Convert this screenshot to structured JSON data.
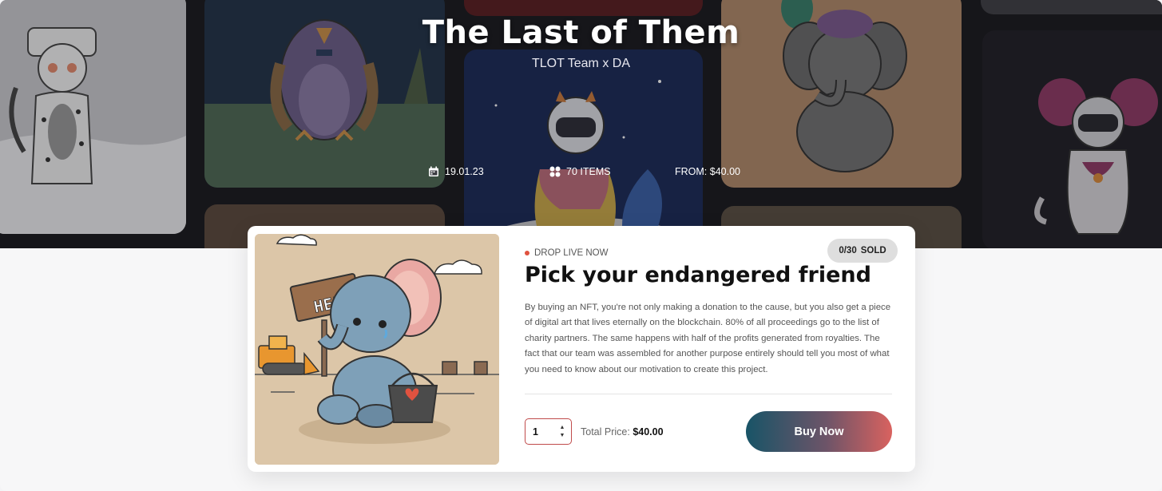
{
  "hero": {
    "title": "The Last of Them",
    "subtitle": "TLOT Team x DA",
    "meta": {
      "date": "19.01.23",
      "items": "70 ITEMS",
      "price_from": "FROM: $40.00"
    }
  },
  "drop": {
    "status": "DROP LIVE NOW",
    "sold_count": "0/30",
    "sold_label": "SOLD",
    "title": "Pick your endangered friend",
    "description": "By buying an NFT, you're not only making a donation to the cause, but you also get a piece of digital art that lives eternally on the blockchain. 80% of all proceedings go to the list of charity partners. The same happens with half of the profits generated from royalties. The fact that our team was assembled for another purpose entirely should tell you most of what you need to know about our motivation to create this project.",
    "artwork": {
      "sign_text": "HELP"
    }
  },
  "purchase": {
    "quantity": "1",
    "total_label": "Total Price:",
    "total_value": "$40.00",
    "buy_label": "Buy Now"
  },
  "colors": {
    "accent_live": "#e0523f",
    "buy_gradient_start": "#185467",
    "buy_gradient_end": "#d9625f",
    "artwork_background": "#dcc6a8"
  },
  "icons": {
    "date": "calendar-icon",
    "items": "grid-dots-icon"
  }
}
